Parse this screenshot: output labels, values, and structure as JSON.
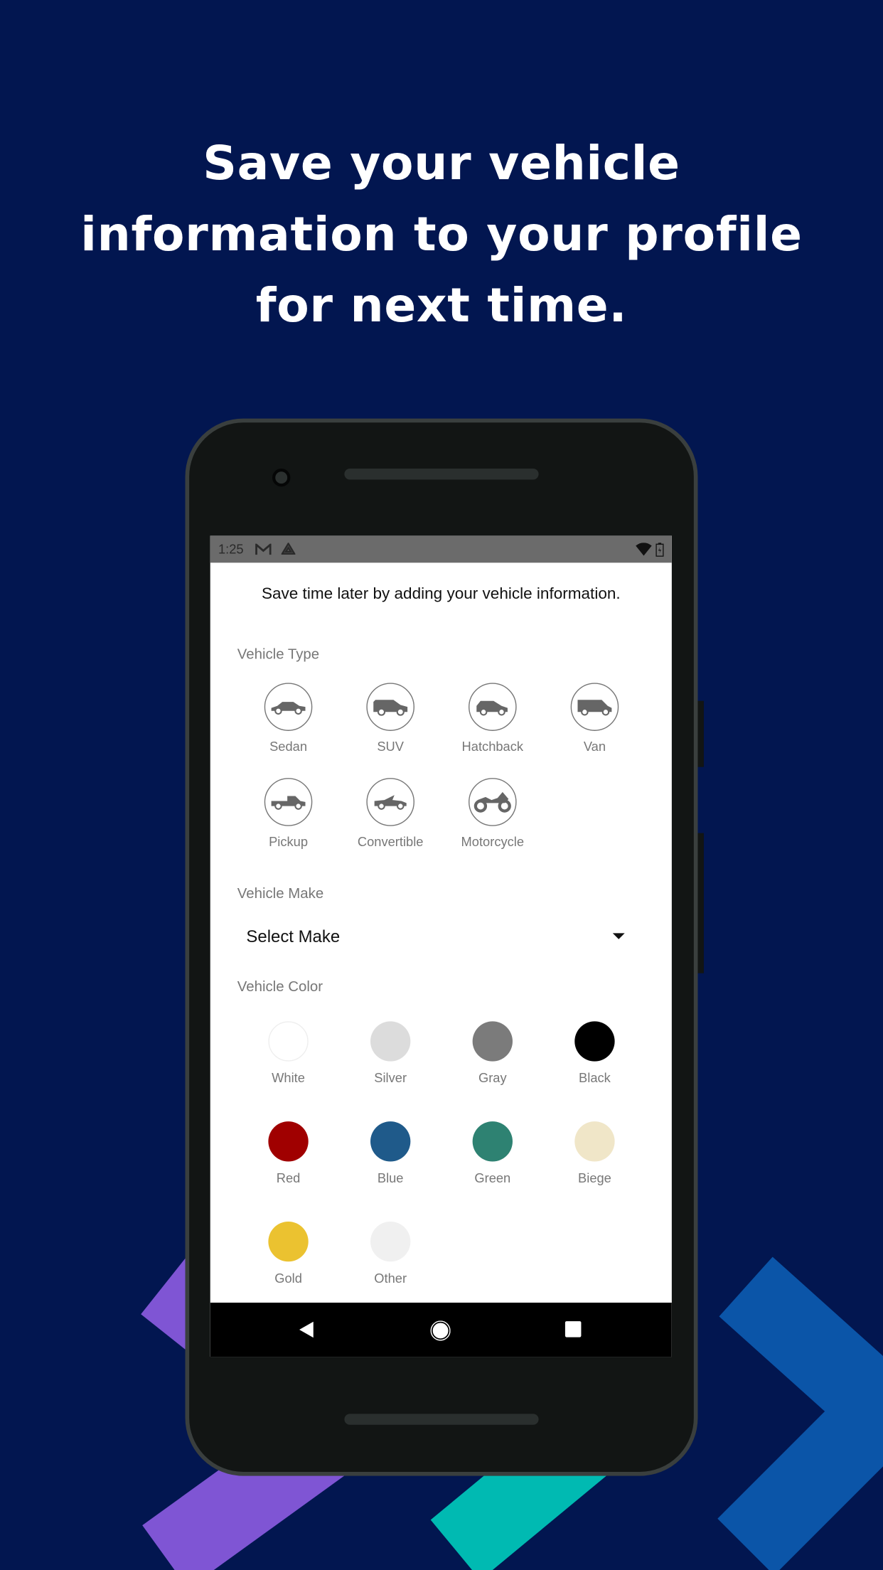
{
  "headline": [
    "Save your vehicle",
    "information to your profile",
    "for next time."
  ],
  "status_bar": {
    "time": "1:25",
    "icons": [
      "gmail-icon",
      "drive-icon",
      "wifi-icon",
      "battery-charging-icon"
    ]
  },
  "intro": "Save time later by adding your vehicle information.",
  "vehicle_type": {
    "label": "Vehicle Type",
    "options": [
      {
        "label": "Sedan",
        "icon": "sedan-icon"
      },
      {
        "label": "SUV",
        "icon": "suv-icon"
      },
      {
        "label": "Hatchback",
        "icon": "hatchback-icon"
      },
      {
        "label": "Van",
        "icon": "van-icon"
      },
      {
        "label": "Pickup",
        "icon": "pickup-icon"
      },
      {
        "label": "Convertible",
        "icon": "convertible-icon"
      },
      {
        "label": "Motorcycle",
        "icon": "motorcycle-icon"
      }
    ]
  },
  "vehicle_make": {
    "label": "Vehicle Make",
    "value": "Select Make"
  },
  "vehicle_color": {
    "label": "Vehicle Color",
    "options": [
      {
        "label": "White",
        "color": "#ffffff"
      },
      {
        "label": "Silver",
        "color": "#dcdcdc"
      },
      {
        "label": "Gray",
        "color": "#7b7b7b"
      },
      {
        "label": "Black",
        "color": "#000000"
      },
      {
        "label": "Red",
        "color": "#a00000"
      },
      {
        "label": "Blue",
        "color": "#1f5a8a"
      },
      {
        "label": "Green",
        "color": "#2e8272"
      },
      {
        "label": "Biege",
        "color": "#f0e6c8"
      },
      {
        "label": "Gold",
        "color": "#ebc230"
      },
      {
        "label": "Other",
        "color": "#f0f0f0"
      }
    ]
  },
  "nav_bar": [
    "back-icon",
    "home-icon",
    "recents-icon"
  ],
  "colors": {
    "background": "#021650",
    "purple": "#7f55d4",
    "teal": "#00bab2",
    "blue": "#0b55a8"
  }
}
